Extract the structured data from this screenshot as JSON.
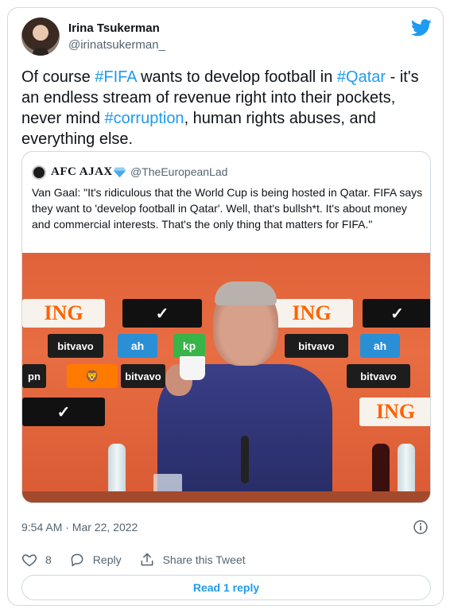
{
  "author": {
    "name": "Irina Tsukerman",
    "handle": "@irinatsukerman_"
  },
  "tweet": {
    "parts": [
      {
        "text": "Of course ",
        "tag": false
      },
      {
        "text": "#FIFA",
        "tag": true
      },
      {
        "text": " wants to develop football in ",
        "tag": false
      },
      {
        "text": "#Qatar",
        "tag": true
      },
      {
        "text": " - it's an endless stream of revenue right into their pockets, never mind ",
        "tag": false
      },
      {
        "text": "#corruption",
        "tag": true
      },
      {
        "text": ", human rights abuses, and everything else.",
        "tag": false
      }
    ]
  },
  "quote": {
    "name": "AFC AJAX",
    "handle": "@TheEuropeanLad",
    "text": "Van Gaal: \"It's ridiculous that the World Cup is being hosted in Qatar. FIFA says they want to 'develop football in Qatar'. Well, that's bullsh*t. It's about money and commercial interests. That's the only thing that matters for FIFA.\""
  },
  "photo": {
    "sponsors": [
      "ING",
      "ING",
      "bitvavo",
      "bitvavo",
      "bitvavo",
      "bitvavo",
      "kp",
      "ING"
    ]
  },
  "timestamp": "9:54 AM · Mar 22, 2022",
  "actions": {
    "likes": "8",
    "reply_label": "Reply",
    "share_label": "Share this Tweet"
  },
  "read_reply_label": "Read 1 reply",
  "colors": {
    "link": "#1d9bf0",
    "muted": "#536471",
    "border": "#cfd9de"
  }
}
